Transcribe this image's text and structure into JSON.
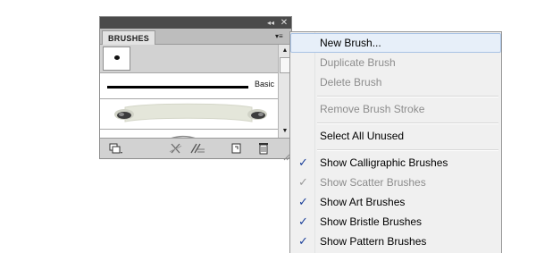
{
  "panel": {
    "tab_label": "BRUSHES",
    "collapse_glyph": "◂◂",
    "close_glyph": "✕",
    "menu_glyph": "▾≡",
    "basic_brush_label": "Basic",
    "scroll_up_glyph": "▲",
    "scroll_down_glyph": "▼",
    "icons": [
      "brush-libraries-menu-icon",
      "remove-brush-stroke-icon",
      "options-of-selected-object-icon",
      "new-brush-icon",
      "delete-brush-icon"
    ]
  },
  "menu": {
    "items": [
      {
        "label": "New Brush...",
        "enabled": true,
        "checked": false,
        "highlighted": true
      },
      {
        "label": "Duplicate Brush",
        "enabled": false,
        "checked": false
      },
      {
        "label": "Delete Brush",
        "enabled": false,
        "checked": false
      },
      {
        "label": "Remove Brush Stroke",
        "enabled": false,
        "checked": false
      },
      {
        "label": "Select All Unused",
        "enabled": true,
        "checked": false
      },
      {
        "label": "Show Calligraphic Brushes",
        "enabled": true,
        "checked": true
      },
      {
        "label": "Show Scatter Brushes",
        "enabled": false,
        "checked": true
      },
      {
        "label": "Show Art Brushes",
        "enabled": true,
        "checked": true
      },
      {
        "label": "Show Bristle Brushes",
        "enabled": true,
        "checked": true
      },
      {
        "label": "Show Pattern Brushes",
        "enabled": true,
        "checked": true
      }
    ],
    "check_glyph": "✓"
  },
  "colors": {
    "panel_topbar": "#4a4a4a",
    "menu_highlight": "#e7eff9",
    "check": "#1b3f9a"
  }
}
